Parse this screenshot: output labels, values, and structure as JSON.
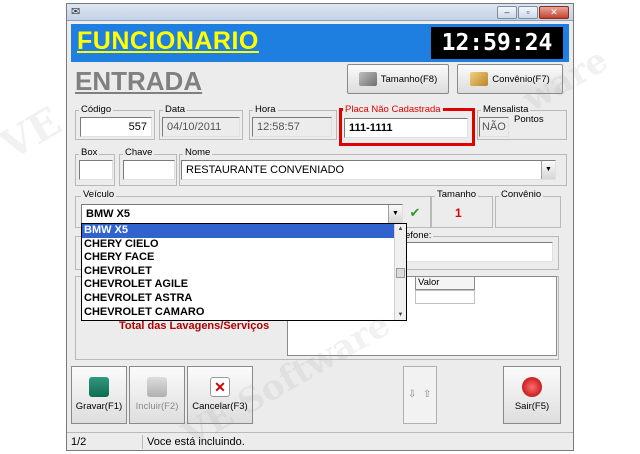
{
  "window": {
    "title_icon": "app-icon",
    "controls": [
      "–",
      "▫",
      "✕"
    ]
  },
  "header": {
    "title": "FUNCIONARIO",
    "clock": "12:59:24"
  },
  "section_title": "ENTRADA",
  "top_buttons": {
    "tamanho": "Tamanho(F8)",
    "convenio": "Convênio(F7)"
  },
  "fields": {
    "codigo": {
      "label": "Código",
      "value": "557"
    },
    "data": {
      "label": "Data",
      "value": "04/10/2011"
    },
    "hora": {
      "label": "Hora",
      "value": "12:58:57"
    },
    "placa": {
      "label": "Placa Não Cadastrada",
      "value": "111-1111"
    },
    "mensalista": {
      "label": "Mensalista",
      "value": "NÃO",
      "pontos_label": "Pontos"
    },
    "box": {
      "label": "Box",
      "value": ""
    },
    "chave": {
      "label": "Chave",
      "value": ""
    },
    "nome": {
      "label": "Nome",
      "value": "RESTAURANTE CONVENIADO"
    },
    "veiculo": {
      "label": "Veículo",
      "value": "BMW X5"
    },
    "tamanho": {
      "label": "Tamanho",
      "value": "1"
    },
    "convenio": {
      "label": "Convênio",
      "value": ""
    },
    "telefone": {
      "label": "efone:"
    }
  },
  "veiculo_options": [
    "BMW X5",
    "CHERY CIELO",
    "CHERY FACE",
    "CHEVROLET",
    "CHEVROLET AGILE",
    "CHEVROLET ASTRA",
    "CHEVROLET CAMARO"
  ],
  "services_table": {
    "header_valor": "Valor",
    "total_label": "Total das Lavagens/Serviços"
  },
  "footer": {
    "gravar": "Gravar(F1)",
    "incluir": "Incluir(F2)",
    "cancelar": "Cancelar(F3)",
    "sair": "Sair(F5)"
  },
  "status": {
    "page": "1/2",
    "message": "Voce está incluindo."
  },
  "watermark": "VE Software",
  "colors": {
    "header_bg": "#1e7fe0",
    "title_fg": "#ffff00",
    "placa_border": "#e00000",
    "selection": "#3163ce",
    "total_fg": "#b00000",
    "tamanho_value": "#e00000"
  }
}
